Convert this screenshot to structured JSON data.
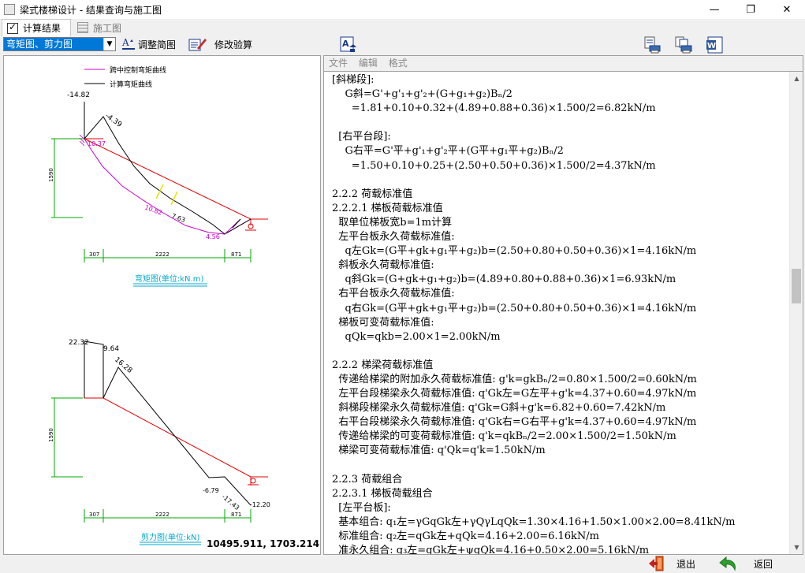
{
  "window": {
    "title": "梁式楼梯设计 - 结果查询与施工图",
    "minimize": "—",
    "restore": "❐",
    "close": "✕"
  },
  "tabs": [
    {
      "label": "计算结果"
    },
    {
      "label": "施工图"
    }
  ],
  "toolbar": {
    "diagram_select": "弯矩图、剪力图",
    "adjust_label": "调整简图",
    "modify_label": "修改验算"
  },
  "menu": {
    "file": "文件",
    "edit": "编辑",
    "format": "格式"
  },
  "coords_readout": "10495.911, 1703.214",
  "moment_diagram": {
    "legend_midspan": "跨中控制弯矩曲线",
    "legend_calc": "计算弯矩曲线",
    "caption": "弯矩图(单位:kN.m)",
    "label_1482": "-14.82",
    "label_439": "-4.39",
    "label_1037": "10.37",
    "label_1082": "10.82",
    "label_763": "7.63",
    "label_456": "4.56",
    "height_dim": "1590",
    "dim_left": "307",
    "dim_mid": "2222",
    "dim_right": "871"
  },
  "shear_diagram": {
    "caption": "剪力图(单位:kN)",
    "label_2232": "22.32",
    "label_964": "9.64",
    "label_1628": "16.28",
    "label_679": "-6.79",
    "label_1743": "-17.43",
    "label_1220": "-12.20",
    "height_dim": "1590",
    "dim_left": "307",
    "dim_mid": "2222",
    "dim_right": "871"
  },
  "report_lines": [
    "[斜梯段]:",
    "    G斜=G'+g'₁+g'₂+(G+g₁+g₂)Bₙ/2",
    "      =1.81+0.10+0.32+(4.89+0.88+0.36)×1.500/2=6.82kN/m",
    "",
    "  [右平台段]:",
    "    G右平=G'平+g'₁+g'₂平+(G平+g₁平+g₂)Bₙ/2",
    "      =1.50+0.10+0.25+(2.50+0.50+0.36)×1.500/2=4.37kN/m",
    "",
    "2.2.2 荷载标准值",
    "2.2.2.1 梯板荷载标准值",
    "  取单位梯板宽b=1m计算",
    "  左平台板永久荷载标准值:",
    "    q左Gk=(G平+gk+g₁平+g₂)b=(2.50+0.80+0.50+0.36)×1=4.16kN/m",
    "  斜板永久荷载标准值:",
    "    q斜Gk=(G+gk+g₁+g₂)b=(4.89+0.80+0.88+0.36)×1=6.93kN/m",
    "  右平台板永久荷载标准值:",
    "    q右Gk=(G平+gk+g₁平+g₂)b=(2.50+0.80+0.50+0.36)×1=4.16kN/m",
    "  梯板可变荷载标准值:",
    "    qQk=qkb=2.00×1=2.00kN/m",
    "",
    "2.2.2 梯梁荷载标准值",
    "  传递给梯梁的附加永久荷载标准值: g'k=gkBₙ/2=0.80×1.500/2=0.60kN/m",
    "  左平台段梯梁永久荷载标准值: q'Gk左=G左平+g'k=4.37+0.60=4.97kN/m",
    "  斜梯段梯梁永久荷载标准值: q'Gk=G斜+g'k=6.82+0.60=7.42kN/m",
    "  右平台段梯梁永久荷载标准值: q'Gk右=G右平+g'k=4.37+0.60=4.97kN/m",
    "  传递给梯梁的可变荷载标准值: q'k=qkBₙ/2=2.00×1.500/2=1.50kN/m",
    "  梯梁可变荷载标准值: q'Qk=q'k=1.50kN/m",
    "",
    "2.2.3 荷载组合",
    "2.2.3.1 梯板荷载组合",
    "  [左平台板]:",
    "  基本组合: q₁左=γGqGk左+γQγLqQk=1.30×4.16+1.50×1.00×2.00=8.41kN/m",
    "  标准组合: q₂左=qGk左+qQk=4.16+2.00=6.16kN/m",
    "  准永久组合: q₃左=qGk左+ψqQk=4.16+0.50×2.00=5.16kN/m"
  ],
  "bottom": {
    "exit_label": "退出",
    "back_label": "返回"
  },
  "colors": {
    "accent": "#0078d7",
    "moment_curve": "#cc00cc",
    "shear_line": "#e00000",
    "caption": "#00aacc"
  }
}
